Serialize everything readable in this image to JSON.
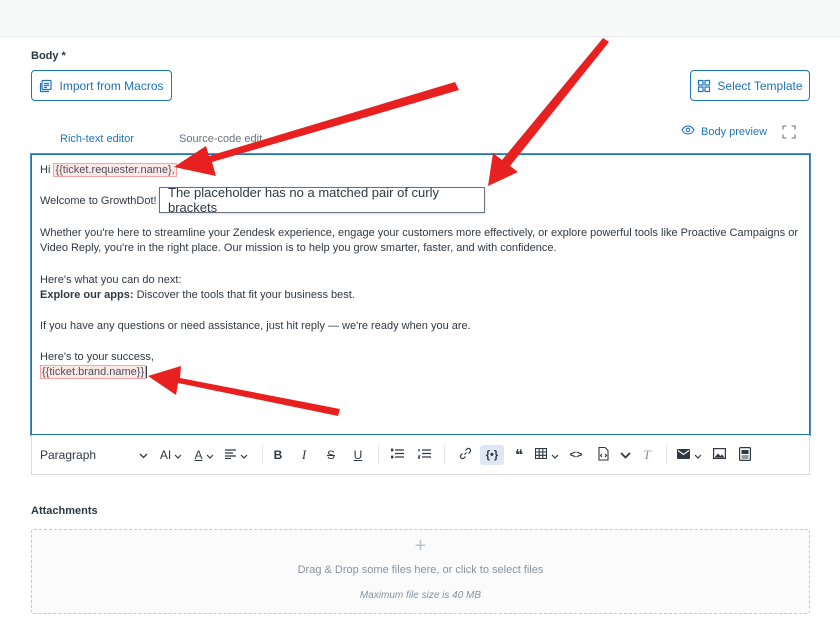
{
  "body_label": "Body *",
  "import_button": "Import from Macros",
  "select_template_button": "Select Template",
  "tabs": [
    {
      "label": "Rich-text editor"
    },
    {
      "label": "Source-code edit"
    }
  ],
  "body_preview": "Body preview",
  "editor": {
    "greeting_prefix": "Hi ",
    "requester_placeholder": "{{ticket.requester.name},",
    "welcome": "Welcome to GrowthDot!",
    "paragraph1_line1": "Whether you're here to streamline your Zendesk experience, engage your customers more effectively, or explore powerful tools like Proactive Campaigns or",
    "paragraph1_line2": "Video Reply, you're in the right place. Our mission is to help you grow smarter, faster, and with confidence.",
    "next_line": "Here's what you can do next:",
    "explore_bold": "Explore our apps:",
    "explore_rest": " Discover the tools that fit your business best.",
    "questions_line": "If you have any questions or need assistance, just hit reply — we're ready when you are.",
    "closing": "Here's to your success,",
    "brand_placeholder": "{{ticket.brand.name}}"
  },
  "tooltip": "The placeholder has no a matched pair of curly brackets",
  "toolbar": {
    "paragraph": "Paragraph",
    "font_size": "AI",
    "font_color": "A",
    "bold": "B",
    "italic": "I",
    "strike": "S",
    "underline": "U",
    "placeholder": "{•}",
    "quote": "❝",
    "code": "<>",
    "clear_format": "T"
  },
  "attachments_label": "Attachments",
  "dropzone": {
    "plus": "+",
    "text": "Drag & Drop some files here, or click to select files",
    "sub": "Maximum file size is 40 MB"
  },
  "colors": {
    "accent": "#1f73b7",
    "annotation_arrow": "#e8201f",
    "placeholder_error_bg": "#fde8e8"
  }
}
